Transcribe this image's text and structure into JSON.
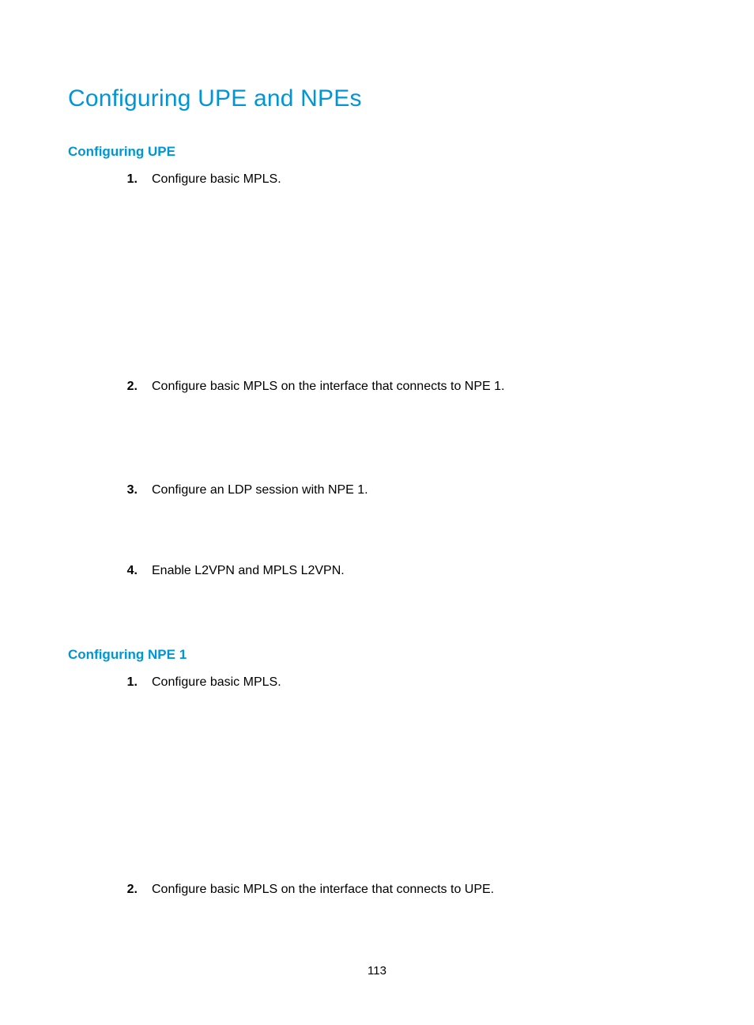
{
  "title": "Configuring UPE and NPEs",
  "sections": [
    {
      "heading": "Configuring UPE",
      "steps": [
        {
          "num": "1.",
          "text": "Configure basic MPLS.",
          "gap_after": "gapA"
        },
        {
          "num": "2.",
          "text": "Configure basic MPLS on the interface that connects to NPE 1.",
          "gap_after": "gapB"
        },
        {
          "num": "3.",
          "text": "Configure an LDP session with NPE 1.",
          "gap_after": "gapC"
        },
        {
          "num": "4.",
          "text": "Enable L2VPN and MPLS L2VPN.",
          "gap_after": "gapD"
        }
      ]
    },
    {
      "heading": "Configuring NPE 1",
      "steps": [
        {
          "num": "1.",
          "text": "Configure basic MPLS.",
          "gap_after": "gapA"
        },
        {
          "num": "2.",
          "text": "Configure basic MPLS on the interface that connects to UPE.",
          "gap_after": "gapE"
        }
      ]
    }
  ],
  "page_number": "113"
}
